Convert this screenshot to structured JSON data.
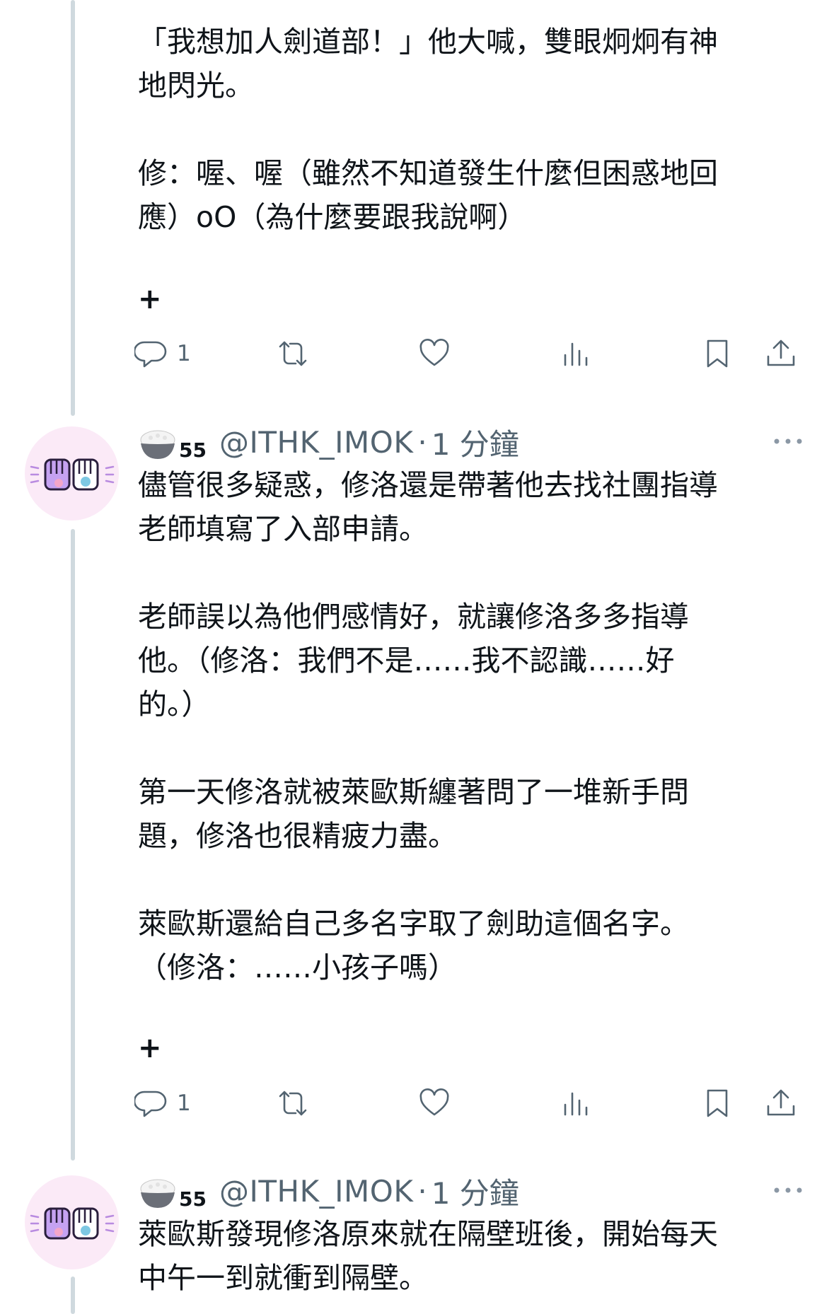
{
  "posts": [
    {
      "text": "「我想加人劍道部！」他大喊，雙眼炯炯有神\n地閃光。\n\n修：喔、喔（雖然不知道發生什麼但困惑地回\n應）oO（為什麼要跟我說啊）",
      "plus": "+",
      "reply_count": "1"
    },
    {
      "display_name": "55",
      "handle": "@ITHK_IMOK",
      "dot": "·",
      "time": "1 分鐘",
      "text": "儘管很多疑惑，修洛還是帶著他去找社團指導\n老師填寫了入部申請。\n\n老師誤以為他們感情好，就讓修洛多多指導\n他。（修洛：我們不是……我不認識……好\n的。）\n\n第一天修洛就被萊歐斯纏著問了一堆新手問\n題，修洛也很精疲力盡。\n\n萊歐斯還給自己多名字取了劍助這個名字。\n（修洛：……小孩子嗎）",
      "plus": "+",
      "reply_count": "1"
    },
    {
      "display_name": "55",
      "handle": "@ITHK_IMOK",
      "dot": "·",
      "time": "1 分鐘",
      "text": "萊歐斯發現修洛原來就在隔壁班後，開始每天\n中午一到就衝到隔壁。"
    }
  ]
}
